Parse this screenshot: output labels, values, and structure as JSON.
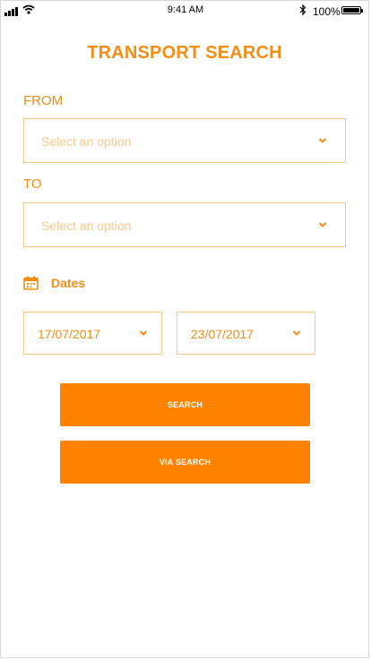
{
  "status_bar": {
    "time": "9:41 AM",
    "battery": "100%"
  },
  "title": "TRANSPORT SEARCH",
  "from": {
    "label": "FROM",
    "placeholder": "Select an option"
  },
  "to": {
    "label": "TO",
    "placeholder": "Select an option"
  },
  "dates": {
    "label": "Dates",
    "start": "17/07/2017",
    "end": "23/07/2017"
  },
  "buttons": {
    "search": "SEARCH",
    "via_search": "VIA SEARCH"
  },
  "colors": {
    "accent": "#f38d14",
    "button": "#ff8200",
    "border": "#f8c98c"
  },
  "icons": [
    "signal-icon",
    "wifi-icon",
    "bluetooth-icon",
    "battery-icon",
    "calendar-icon",
    "chevron-down-icon"
  ]
}
